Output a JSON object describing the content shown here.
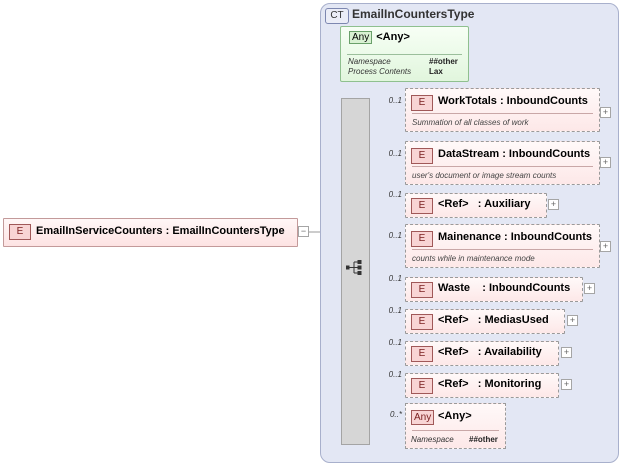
{
  "complex_type": {
    "badge": "CT",
    "name": "EmailInCountersType"
  },
  "root_element": {
    "badge": "E",
    "label": "EmailInServiceCounters : EmailInCountersType"
  },
  "any_attribute": {
    "badge": "Any",
    "title": "<Any>",
    "namespace_label": "Namespace",
    "namespace_value": "##other",
    "process_label": "Process Contents",
    "process_value": "Lax"
  },
  "children": [
    {
      "occurs": "0..1",
      "badge": "E",
      "name": "WorkTotals",
      "type": "InboundCounts",
      "sep": " : ",
      "desc": "Summation of all classes of work"
    },
    {
      "occurs": "0..1",
      "badge": "E",
      "name": "DataStream",
      "type": "InboundCounts",
      "sep": " : ",
      "desc": "user's document or image stream counts"
    },
    {
      "occurs": "0..1",
      "badge": "E",
      "name": "<Ref>",
      "type": "Auxiliary",
      "sep": "   : "
    },
    {
      "occurs": "0..1",
      "badge": "E",
      "name": "Mainenance",
      "type": "InboundCounts",
      "sep": " : ",
      "desc": "counts while in maintenance mode"
    },
    {
      "occurs": "0..1",
      "badge": "E",
      "name": "Waste",
      "type": "InboundCounts",
      "sep": "    : "
    },
    {
      "occurs": "0..1",
      "badge": "E",
      "name": "<Ref>",
      "type": "MediasUsed",
      "sep": "   : "
    },
    {
      "occurs": "0..1",
      "badge": "E",
      "name": "<Ref>",
      "type": "Availability",
      "sep": "   : "
    },
    {
      "occurs": "0..1",
      "badge": "E",
      "name": "<Ref>",
      "type": "Monitoring",
      "sep": "   : "
    }
  ],
  "any_element": {
    "occurs": "0..*",
    "badge": "Any",
    "title": "<Any>",
    "namespace_label": "Namespace",
    "namespace_value": "##other"
  },
  "icons": {
    "expand": "plus-icon",
    "collapse": "minus-icon",
    "sequence": "sequence-icon"
  },
  "colors": {
    "element_fill": "#fde3e3",
    "any_fill": "#e1f6dd",
    "complex_type_panel": "#e3e7f4"
  }
}
